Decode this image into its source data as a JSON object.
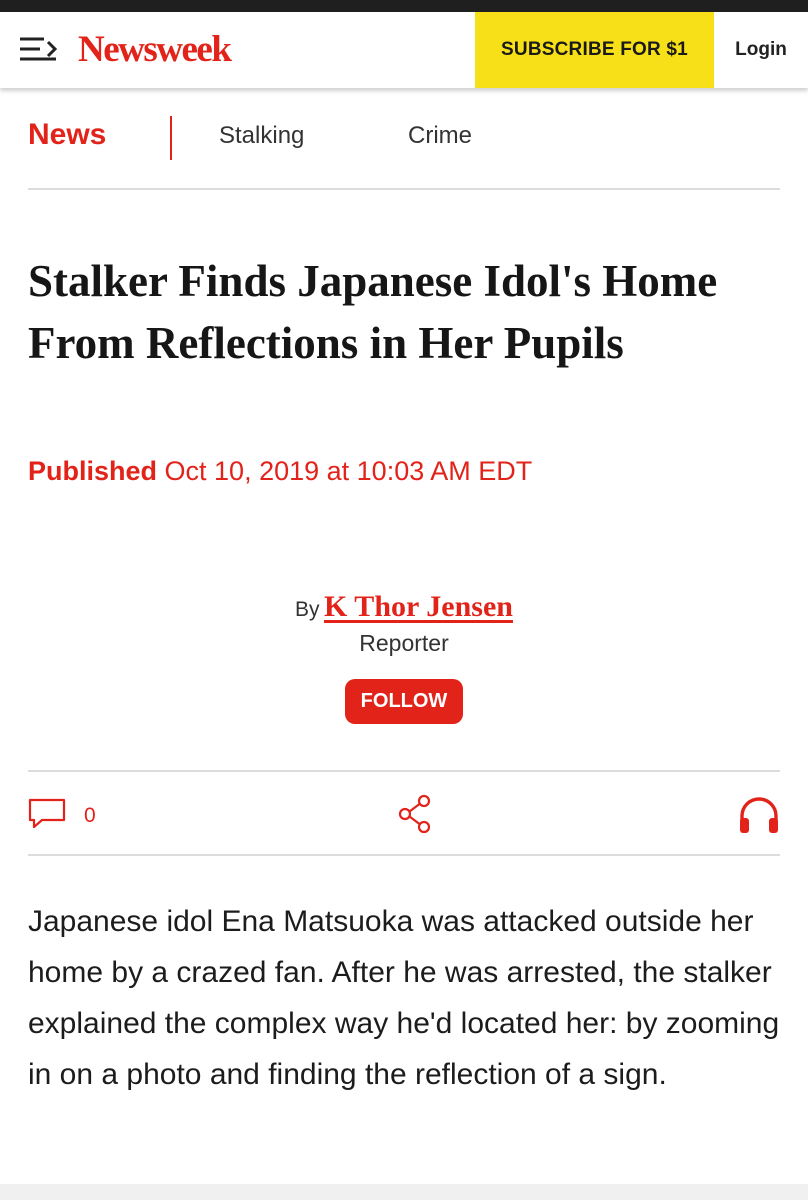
{
  "header": {
    "logo_text": "Newsweek",
    "subscribe_label": "SUBSCRIBE FOR $1",
    "login_label": "Login",
    "brand_color": "#e2231a",
    "subscribe_color": "#f7e017",
    "menu_icon": "menu-icon"
  },
  "section_nav": {
    "primary": "News",
    "tags": [
      "Stalking",
      "Crime"
    ]
  },
  "article": {
    "headline": "Stalker Finds Japanese Idol's Home From Reflections in Her Pupils",
    "published_label": "Published",
    "published_date": "Oct 10, 2019 at 10:03 AM EDT",
    "by_prefix": "By",
    "author": "K Thor Jensen",
    "author_role": "Reporter",
    "follow_label": "FOLLOW",
    "body": "Japanese idol Ena Matsuoka was attacked outside her home by a crazed fan. After he was arrested, the stalker explained the complex way he'd located her: by zooming in on a photo and finding the reflection of a sign."
  },
  "social": {
    "comment_icon": "comment-icon",
    "comment_count": "0",
    "share_icon": "share-icon",
    "listen_icon": "headphones-icon"
  }
}
